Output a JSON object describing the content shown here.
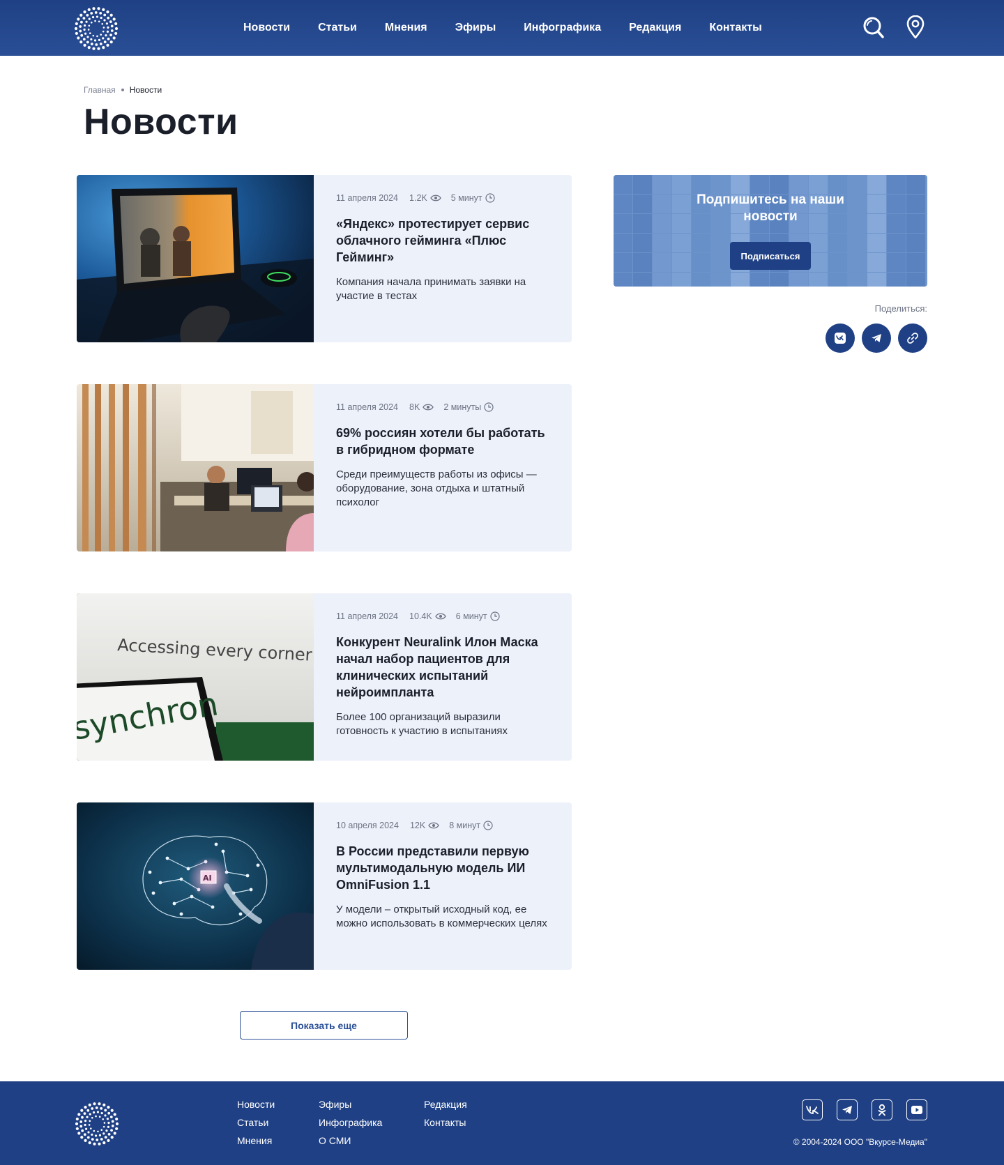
{
  "header": {
    "nav": [
      "Новости",
      "Статьи",
      "Мнения",
      "Эфиры",
      "Инфографика",
      "Редакция",
      "Контакты"
    ],
    "icons": [
      "search-icon",
      "location-pin-icon"
    ],
    "bg_color": "#1f4084"
  },
  "breadcrumb": {
    "home": "Главная",
    "current": "Новости"
  },
  "page_title": "Новости",
  "news": [
    {
      "date": "11 апреля 2024",
      "views": "1.2K",
      "read_time": "5 минут",
      "title": "«Яндекс» протестирует сервис облачного гейминга «Плюс Гейминг»",
      "lead": "Компания начала принимать заявки на участие в тестах",
      "image": "laptop-game-image"
    },
    {
      "date": "11 апреля 2024",
      "views": "8K",
      "read_time": "2 минуты",
      "title": "69% россиян хотели бы работать в гибридном формате",
      "lead": "Среди преимуществ работы из офисы — оборудование, зона отдыха и штатный психолог",
      "image": "office-image"
    },
    {
      "date": "11 апреля 2024",
      "views": "10.4K",
      "read_time": "6 минут",
      "title": "Конкурент Neuralink Илон Маска начал набор пациентов для клинических испытаний нейроимпланта",
      "lead": "Более 100 организаций выразили готовность к участию в испытаниях",
      "image": "synchron-image",
      "image_text": {
        "screen": "Accessing every corner of the brain.",
        "phone": "synchron"
      }
    },
    {
      "date": "10 апреля 2024",
      "views": "12K",
      "read_time": "8 минут",
      "title": "В России представили первую мультимодальную модель ИИ OmniFusion 1.1",
      "lead": "У модели – открытый исходный код, ее можно использовать в коммерческих целях",
      "image": "ai-brain-image",
      "image_text": {
        "chip": "AI"
      }
    }
  ],
  "more_button": "Показать еще",
  "sidebar": {
    "subscribe_title": "Подпишитесь на наши новости",
    "subscribe_button": "Подписаться",
    "share_label": "Поделиться:",
    "share_icons": [
      "vk-icon",
      "telegram-icon",
      "link-icon"
    ]
  },
  "footer": {
    "col1": [
      "Новости",
      "Статьи",
      "Мнения"
    ],
    "col2": [
      "Эфиры",
      "Инфографика",
      "О СМИ"
    ],
    "col3": [
      "Редакция",
      "Контакты"
    ],
    "social_icons": [
      "vk-icon",
      "telegram-icon",
      "odnoklassniki-icon",
      "youtube-icon"
    ],
    "copyright": "© 2004-2024 ООО \"Вкурсе-Медиа\""
  }
}
